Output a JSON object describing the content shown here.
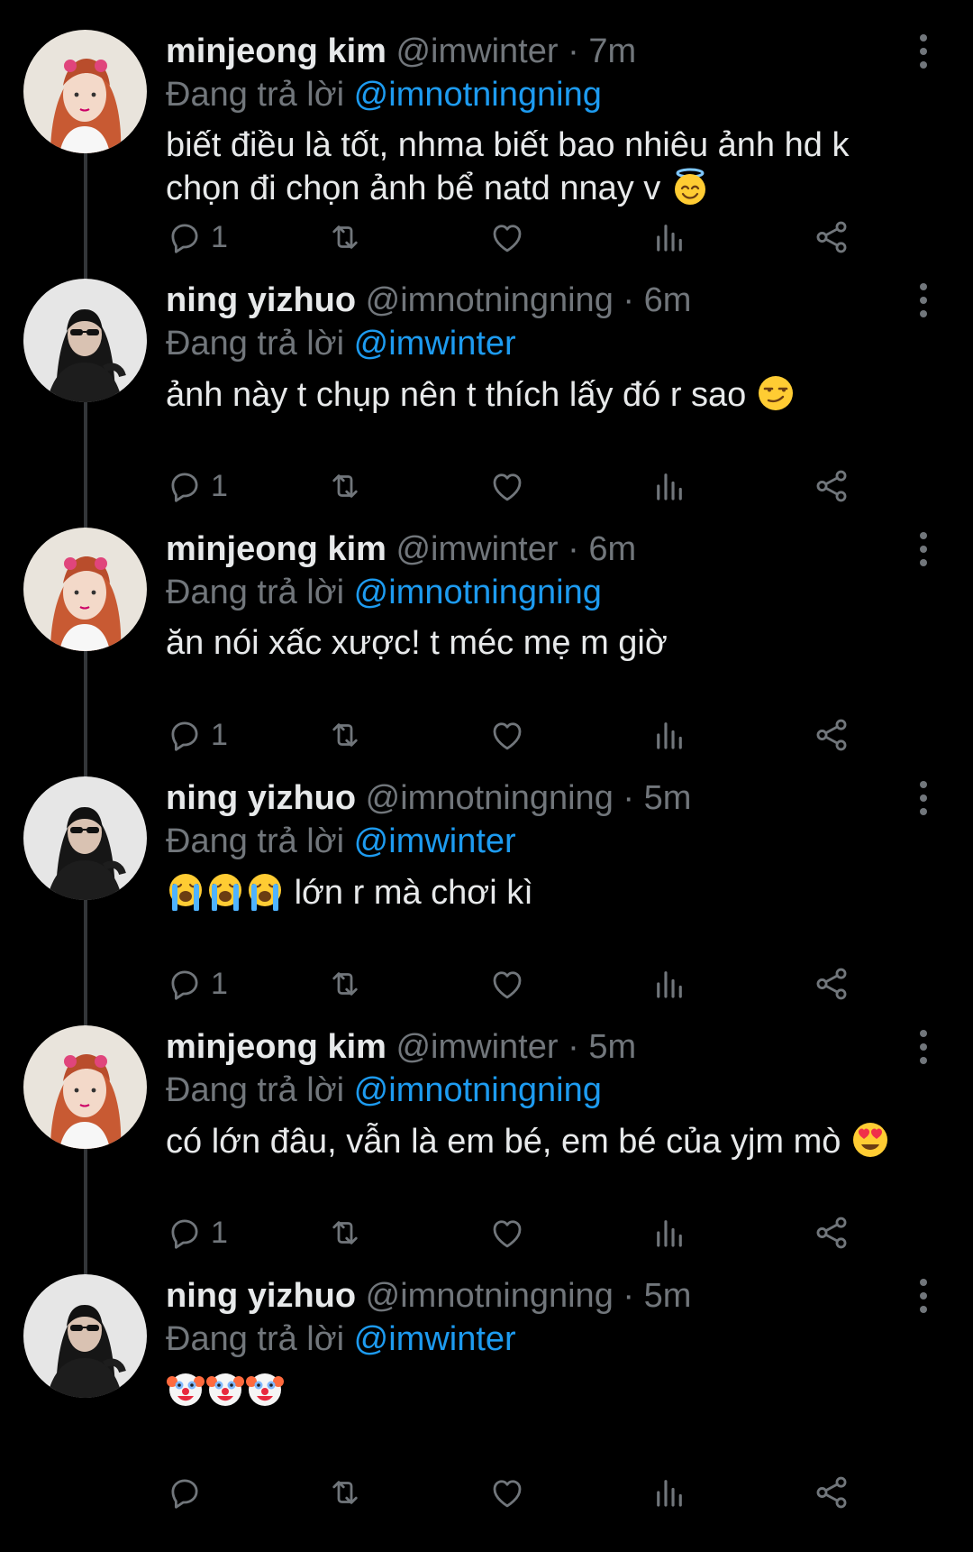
{
  "colors": {
    "background": "#000000",
    "text": "#e7e9ea",
    "muted": "#71767b",
    "accent": "#1d9bf0",
    "thread_line": "#333639"
  },
  "tweets": [
    {
      "name": "minjeong kim",
      "handle": "@imwinter",
      "dot": "·",
      "time": "7m",
      "reply_label": "Đang trả lời",
      "reply_to": "@imnotningning",
      "text_lines": [
        "biết điều là tốt, nhma biết bao nhiêu ảnh hd k",
        "chọn đi chọn ảnh bể natd nnay v"
      ],
      "trailing_emoji": "smiling-face-with-halo",
      "reply_count": "1",
      "avatar": "minjeong-avatar"
    },
    {
      "name": "ning yizhuo",
      "handle": "@imnotningning",
      "dot": "·",
      "time": "6m",
      "reply_label": "Đang trả lời",
      "reply_to": "@imwinter",
      "text_lines": [
        "ảnh này t chụp nên t thích lấy đó r sao"
      ],
      "trailing_emoji": "smirking-face",
      "reply_count": "1",
      "avatar": "ningning-avatar"
    },
    {
      "name": "minjeong kim",
      "handle": "@imwinter",
      "dot": "·",
      "time": "6m",
      "reply_label": "Đang trả lời",
      "reply_to": "@imnotningning",
      "text_lines": [
        "ăn nói xấc xược! t méc mẹ m giờ"
      ],
      "trailing_emoji": "",
      "reply_count": "1",
      "avatar": "minjeong-avatar"
    },
    {
      "name": "ning yizhuo",
      "handle": "@imnotningning",
      "dot": "·",
      "time": "5m",
      "reply_label": "Đang trả lời",
      "reply_to": "@imwinter",
      "leading_emoji": "loudly-crying-face",
      "leading_emoji_count": 3,
      "text_lines": [
        "lớn r mà chơi kì"
      ],
      "trailing_emoji": "",
      "reply_count": "1",
      "avatar": "ningning-avatar"
    },
    {
      "name": "minjeong kim",
      "handle": "@imwinter",
      "dot": "·",
      "time": "5m",
      "reply_label": "Đang trả lời",
      "reply_to": "@imnotningning",
      "text_lines": [
        "có lớn đâu, vẫn là em bé, em bé của yjm mò"
      ],
      "trailing_emoji": "smiling-face-with-heart-eyes",
      "reply_count": "1",
      "avatar": "minjeong-avatar"
    },
    {
      "name": "ning yizhuo",
      "handle": "@imnotningning",
      "dot": "·",
      "time": "5m",
      "reply_label": "Đang trả lời",
      "reply_to": "@imwinter",
      "leading_emoji": "clown-face",
      "leading_emoji_count": 3,
      "text_lines": [],
      "trailing_emoji": "",
      "reply_count": "",
      "avatar": "ningning-avatar"
    }
  ],
  "action_icons": [
    "reply-icon",
    "retweet-icon",
    "like-icon",
    "views-icon",
    "share-icon"
  ]
}
